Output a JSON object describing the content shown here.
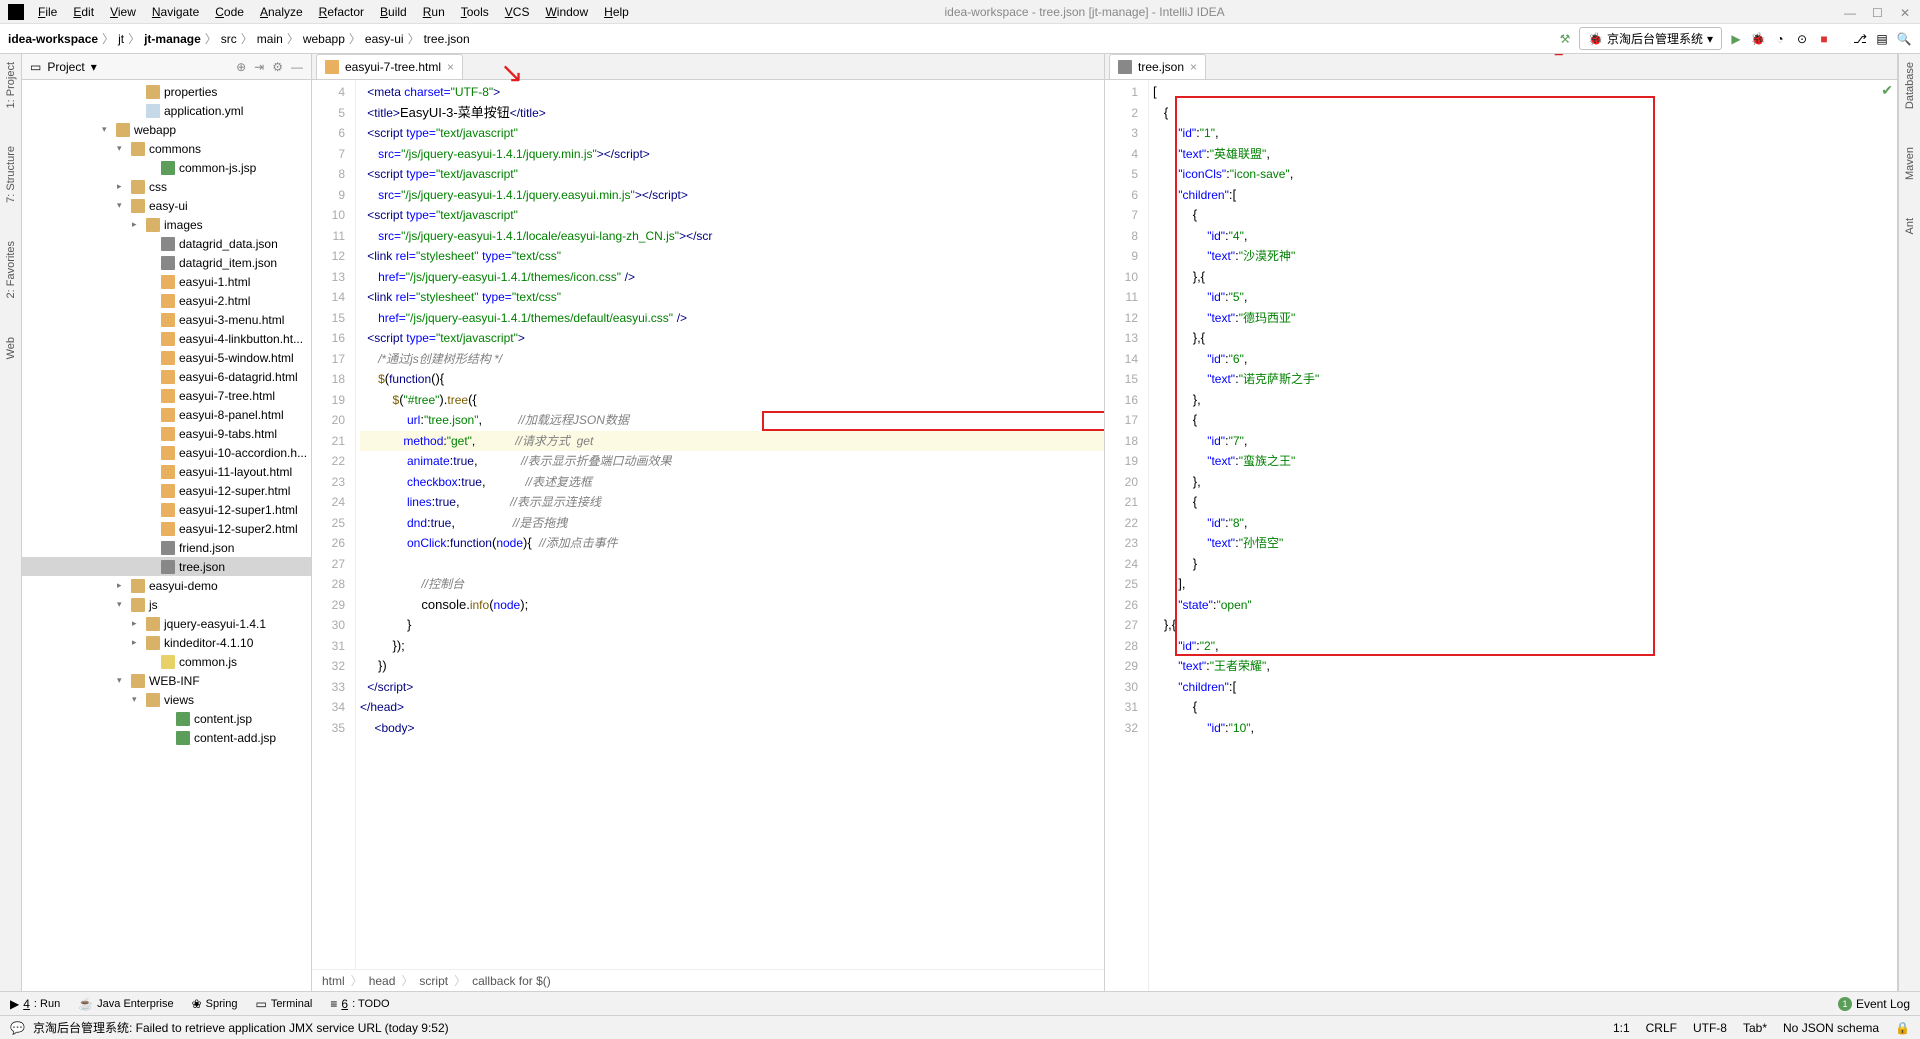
{
  "window": {
    "title": "idea-workspace - tree.json [jt-manage] - IntelliJ IDEA"
  },
  "menu": [
    "File",
    "Edit",
    "View",
    "Navigate",
    "Code",
    "Analyze",
    "Refactor",
    "Build",
    "Run",
    "Tools",
    "VCS",
    "Window",
    "Help"
  ],
  "breadcrumb": [
    "idea-workspace",
    "jt",
    "jt-manage",
    "src",
    "main",
    "webapp",
    "easy-ui",
    "tree.json"
  ],
  "run_config": "京淘后台管理系统",
  "project_panel_title": "Project",
  "tree": [
    {
      "indent": 110,
      "arrow": "",
      "icon": "folder",
      "label": "properties"
    },
    {
      "indent": 110,
      "arrow": "",
      "icon": "file",
      "label": "application.yml"
    },
    {
      "indent": 80,
      "arrow": "▾",
      "icon": "folder",
      "label": "webapp"
    },
    {
      "indent": 95,
      "arrow": "▾",
      "icon": "folder",
      "label": "commons"
    },
    {
      "indent": 125,
      "arrow": "",
      "icon": "jsp",
      "label": "common-js.jsp"
    },
    {
      "indent": 95,
      "arrow": "▸",
      "icon": "folder",
      "label": "css"
    },
    {
      "indent": 95,
      "arrow": "▾",
      "icon": "folder",
      "label": "easy-ui"
    },
    {
      "indent": 110,
      "arrow": "▸",
      "icon": "folder",
      "label": "images"
    },
    {
      "indent": 125,
      "arrow": "",
      "icon": "json",
      "label": "datagrid_data.json"
    },
    {
      "indent": 125,
      "arrow": "",
      "icon": "json",
      "label": "datagrid_item.json"
    },
    {
      "indent": 125,
      "arrow": "",
      "icon": "html",
      "label": "easyui-1.html"
    },
    {
      "indent": 125,
      "arrow": "",
      "icon": "html",
      "label": "easyui-2.html"
    },
    {
      "indent": 125,
      "arrow": "",
      "icon": "html",
      "label": "easyui-3-menu.html"
    },
    {
      "indent": 125,
      "arrow": "",
      "icon": "html",
      "label": "easyui-4-linkbutton.ht..."
    },
    {
      "indent": 125,
      "arrow": "",
      "icon": "html",
      "label": "easyui-5-window.html"
    },
    {
      "indent": 125,
      "arrow": "",
      "icon": "html",
      "label": "easyui-6-datagrid.html"
    },
    {
      "indent": 125,
      "arrow": "",
      "icon": "html",
      "label": "easyui-7-tree.html"
    },
    {
      "indent": 125,
      "arrow": "",
      "icon": "html",
      "label": "easyui-8-panel.html"
    },
    {
      "indent": 125,
      "arrow": "",
      "icon": "html",
      "label": "easyui-9-tabs.html"
    },
    {
      "indent": 125,
      "arrow": "",
      "icon": "html",
      "label": "easyui-10-accordion.h..."
    },
    {
      "indent": 125,
      "arrow": "",
      "icon": "html",
      "label": "easyui-11-layout.html"
    },
    {
      "indent": 125,
      "arrow": "",
      "icon": "html",
      "label": "easyui-12-super.html"
    },
    {
      "indent": 125,
      "arrow": "",
      "icon": "html",
      "label": "easyui-12-super1.html"
    },
    {
      "indent": 125,
      "arrow": "",
      "icon": "html",
      "label": "easyui-12-super2.html"
    },
    {
      "indent": 125,
      "arrow": "",
      "icon": "json",
      "label": "friend.json"
    },
    {
      "indent": 125,
      "arrow": "",
      "icon": "json",
      "label": "tree.json",
      "selected": true
    },
    {
      "indent": 95,
      "arrow": "▸",
      "icon": "folder",
      "label": "easyui-demo"
    },
    {
      "indent": 95,
      "arrow": "▾",
      "icon": "folder",
      "label": "js"
    },
    {
      "indent": 110,
      "arrow": "▸",
      "icon": "folder",
      "label": "jquery-easyui-1.4.1"
    },
    {
      "indent": 110,
      "arrow": "▸",
      "icon": "folder",
      "label": "kindeditor-4.1.10"
    },
    {
      "indent": 125,
      "arrow": "",
      "icon": "js",
      "label": "common.js"
    },
    {
      "indent": 95,
      "arrow": "▾",
      "icon": "folder",
      "label": "WEB-INF"
    },
    {
      "indent": 110,
      "arrow": "▾",
      "icon": "folder",
      "label": "views"
    },
    {
      "indent": 140,
      "arrow": "",
      "icon": "jsp",
      "label": "content.jsp"
    },
    {
      "indent": 140,
      "arrow": "",
      "icon": "jsp",
      "label": "content-add.jsp"
    }
  ],
  "tab_left": "easyui-7-tree.html",
  "tab_right": "tree.json",
  "left_lines_start": 4,
  "left_lines_end": 35,
  "right_lines_start": 1,
  "right_lines_end": 32,
  "breadcrumb_editor": [
    "html",
    "head",
    "script",
    "callback for $()"
  ],
  "bottom_tabs": [
    {
      "icon": "▶",
      "label": "4: Run",
      "u": "4"
    },
    {
      "icon": "☕",
      "label": "Java Enterprise"
    },
    {
      "icon": "❀",
      "label": "Spring"
    },
    {
      "icon": "▭",
      "label": "Terminal"
    },
    {
      "icon": "≡",
      "label": "6: TODO",
      "u": "6"
    }
  ],
  "event_log": "Event Log",
  "status_msg": "京淘后台管理系统: Failed to retrieve application JMX service URL (today 9:52)",
  "status_right": [
    "1:1",
    "CRLF",
    "UTF-8",
    "Tab*",
    "No JSON schema"
  ],
  "left_gutter": [
    "1: Project",
    "7: Structure",
    "2: Favorites",
    "Web"
  ],
  "right_gutter": [
    "Database",
    "Maven",
    "Ant"
  ]
}
